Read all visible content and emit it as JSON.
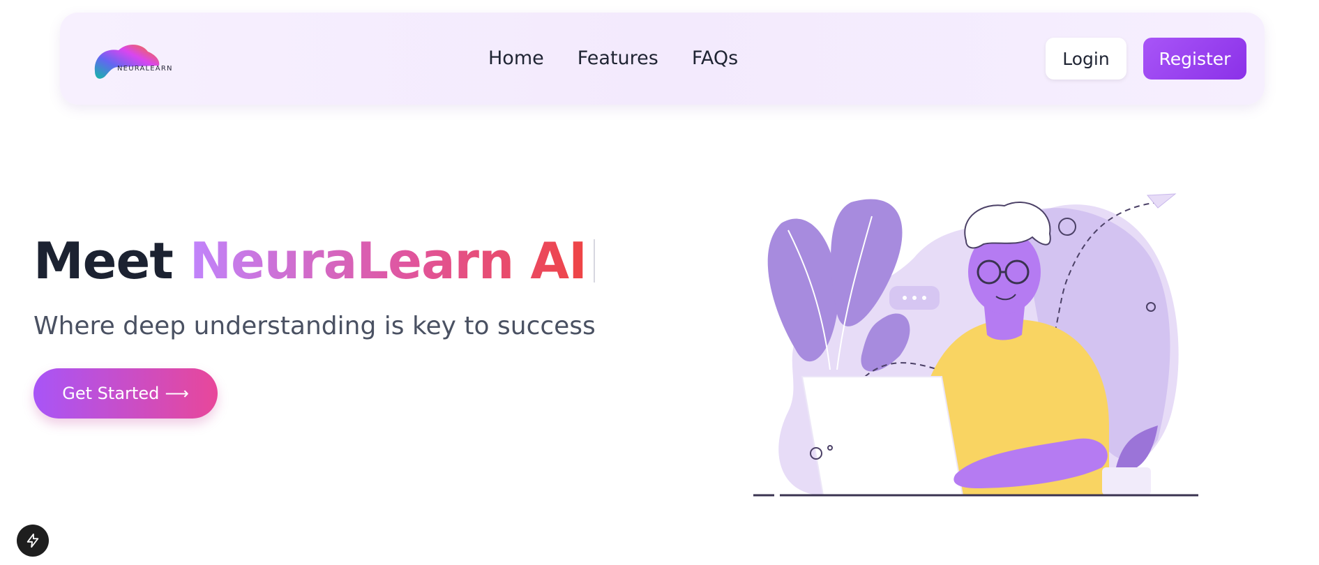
{
  "navbar": {
    "logo_text": "NEURALEARN",
    "links": [
      {
        "label": "Home"
      },
      {
        "label": "Features"
      },
      {
        "label": "FAQs"
      }
    ],
    "login_label": "Login",
    "register_label": "Register"
  },
  "hero": {
    "title_prefix": "Meet ",
    "title_accent": "NeuraLearn AI",
    "subtitle": "Where deep understanding is key to success",
    "cta_label": "Get Started",
    "cta_arrow": "⟶"
  },
  "icons": {
    "flash": "lightning-bolt-icon",
    "illustration": "person-with-laptop-illustration"
  },
  "colors": {
    "brand_purple": "#a855f7",
    "brand_pink": "#e8479a",
    "accent_red": "#ef4444",
    "text_dark": "#1c2231"
  }
}
